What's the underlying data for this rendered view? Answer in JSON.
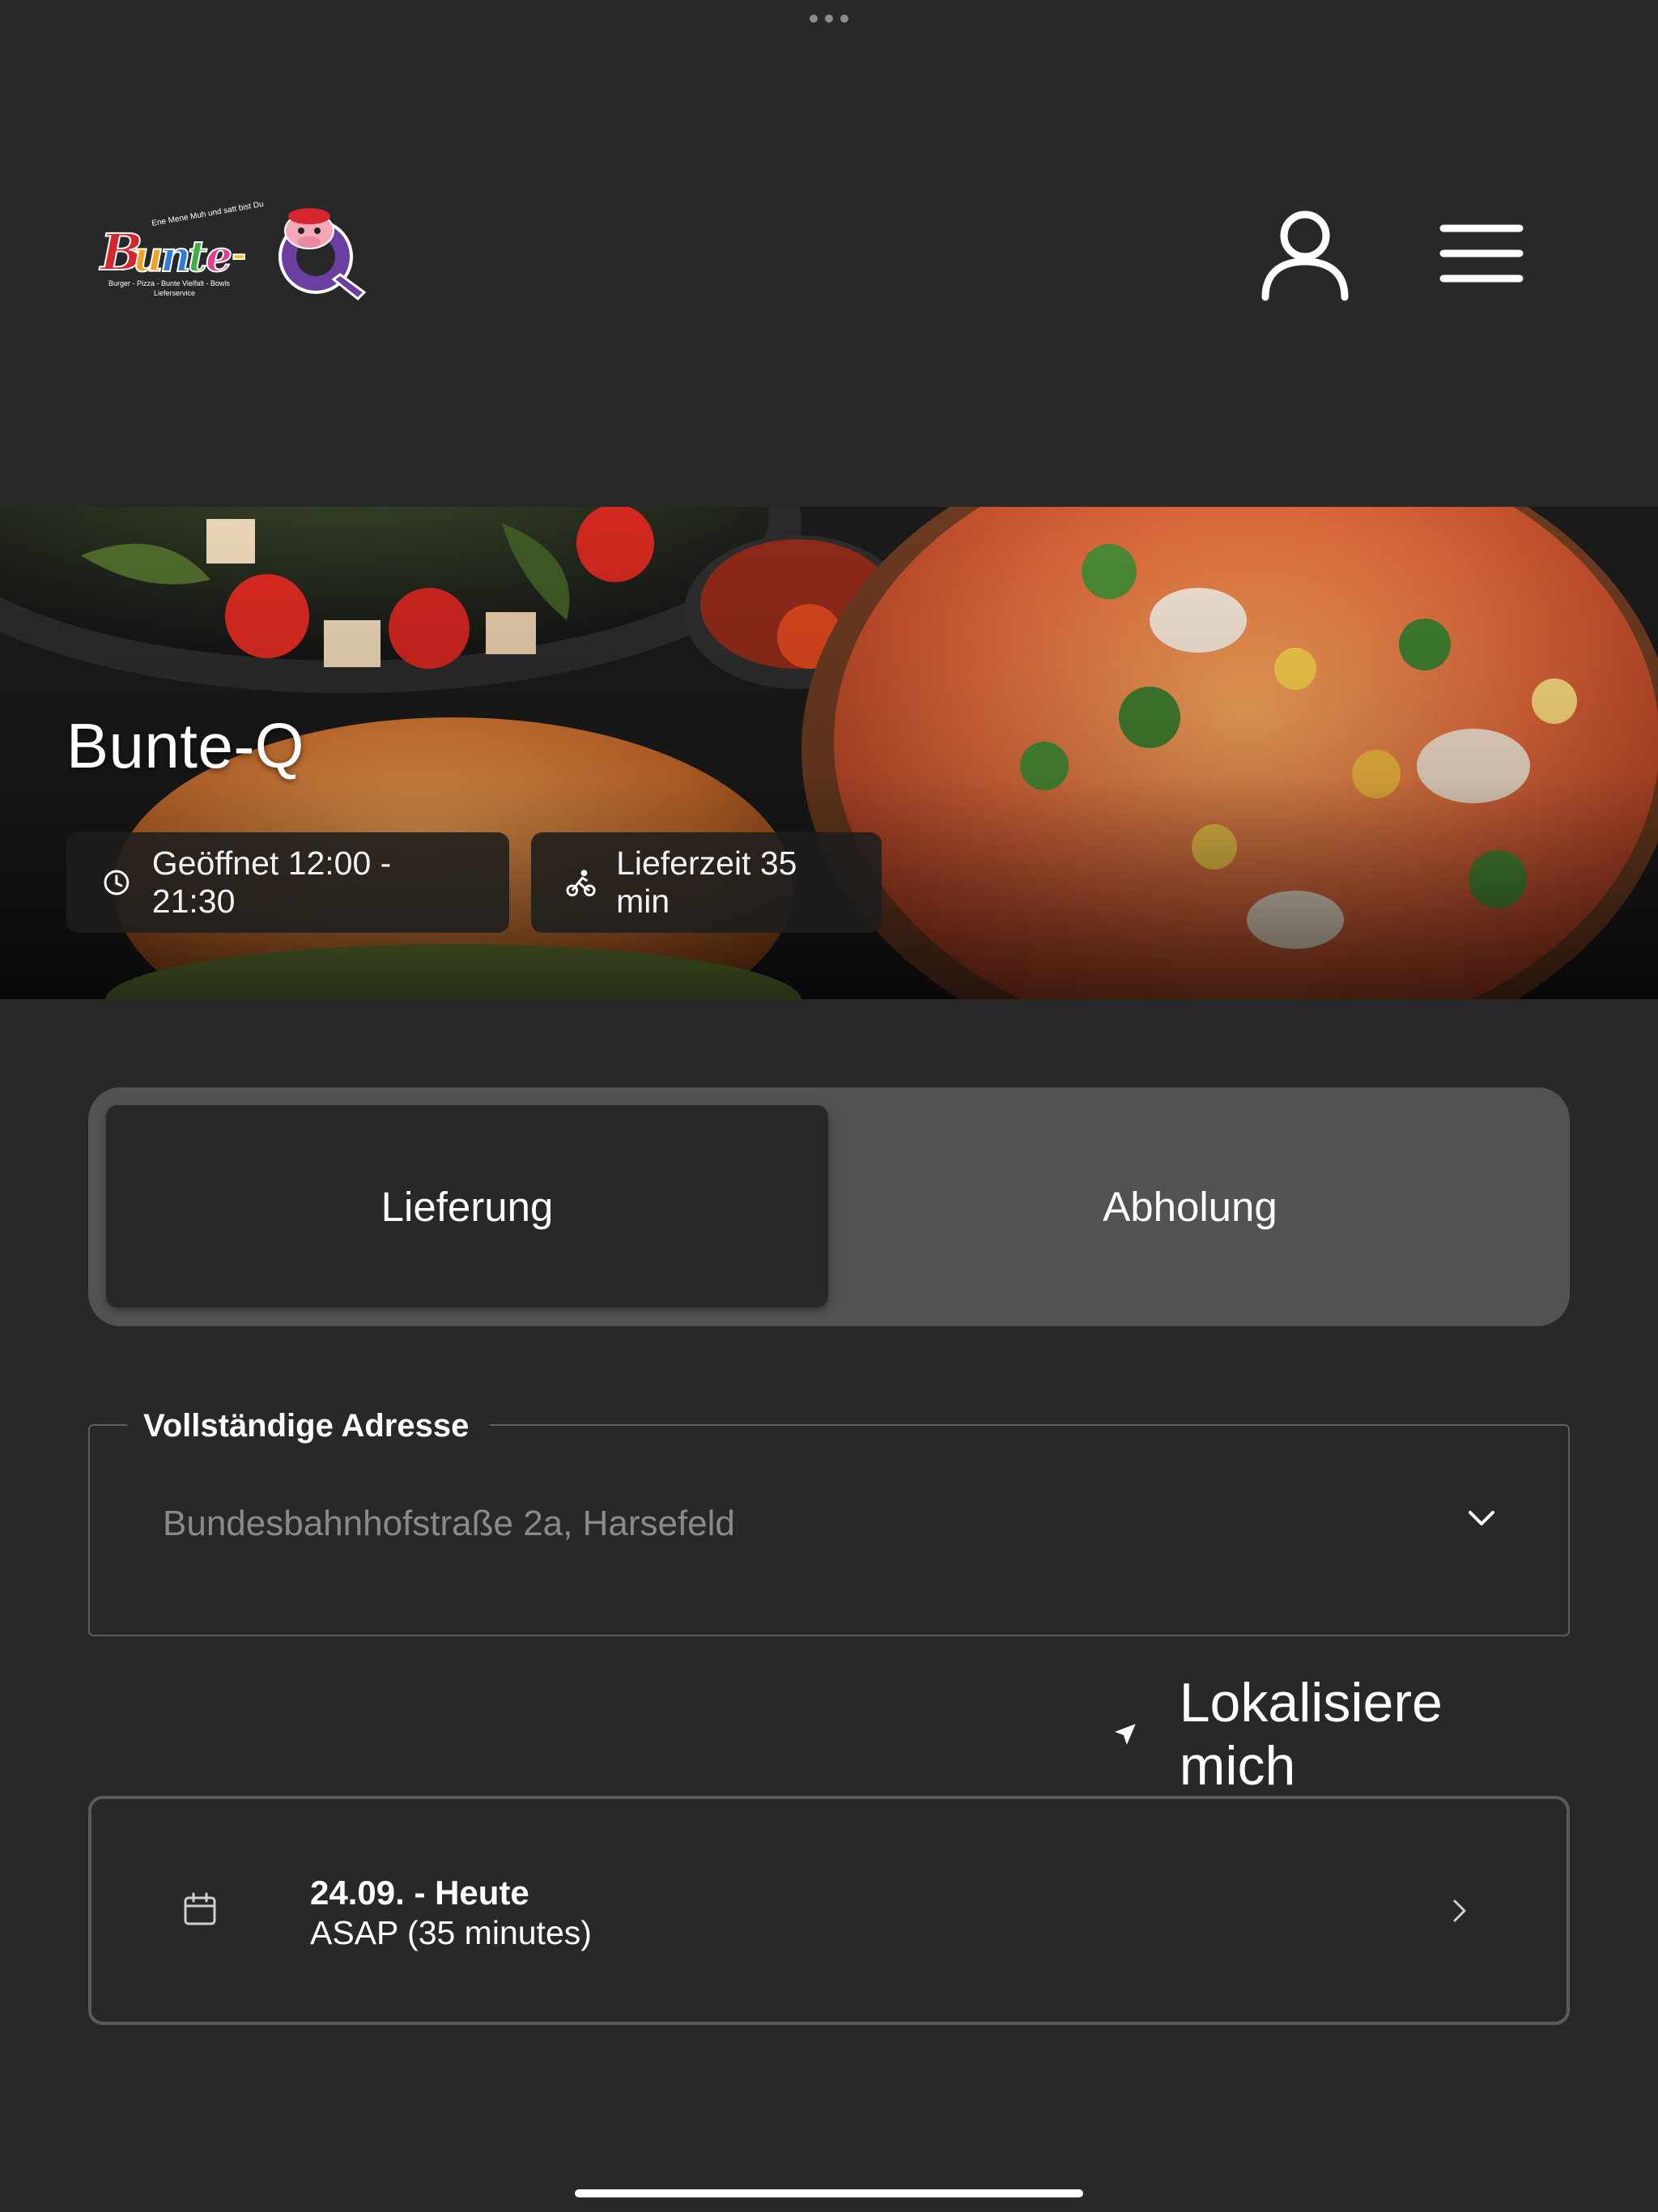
{
  "app": {
    "brand_name": "Bunte-Q",
    "logo_tagline": "Ene Mene Muh und satt bist Du",
    "logo_subline": "Burger - Pizza - Bunte Vielfalt - Bowls",
    "logo_service": "Lieferservice"
  },
  "header": {
    "account_icon": "user-icon",
    "menu_icon": "hamburger-menu-icon"
  },
  "hero": {
    "title": "Bunte-Q",
    "opening_hours": "Geöffnet 12:00 - 21:30",
    "delivery_time": "Lieferzeit 35 min",
    "opening_icon": "clock-icon",
    "delivery_icon": "bicycle-courier-icon"
  },
  "order_type": {
    "options": [
      "Lieferung",
      "Abholung"
    ],
    "selected": "Lieferung"
  },
  "address": {
    "label": "Vollständige Adresse",
    "placeholder": "Bundesbahnhofstraße 2a, Harsefeld",
    "value": ""
  },
  "locate": {
    "label": "Lokalisiere mich",
    "icon": "location-arrow-icon"
  },
  "schedule": {
    "date": "24.09. - Heute",
    "time": "ASAP (35 minutes)",
    "icon": "calendar-icon"
  },
  "colors": {
    "background": "#282828",
    "toggle_track": "#525252",
    "text": "#ffffff",
    "muted": "#8a8a8a"
  }
}
